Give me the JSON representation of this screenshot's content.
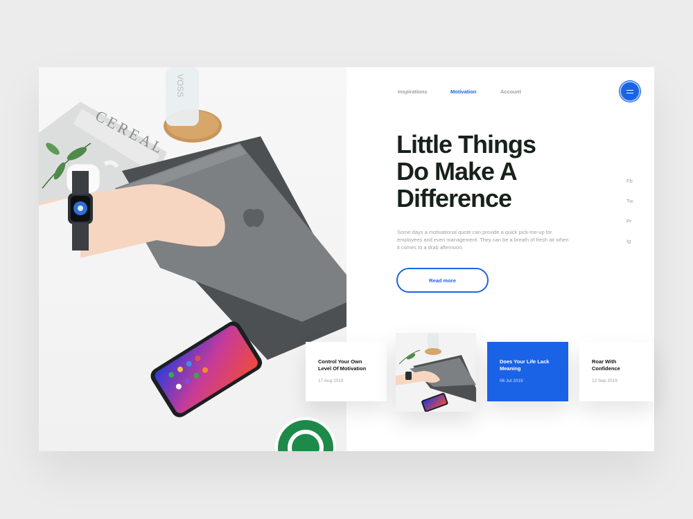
{
  "nav": {
    "items": [
      {
        "label": "Inspirations",
        "active": false
      },
      {
        "label": "Motivation",
        "active": true
      },
      {
        "label": "Account",
        "active": false
      }
    ]
  },
  "hero": {
    "title_line1": "Little Things",
    "title_line2": "Do Make A",
    "title_line3": "Difference",
    "description": "Some days a motivational quote can provide a quick pick-me-up for employees and even management. They can be a breath of fresh air when it comes to a drab afternoon.",
    "cta_label": "Read more"
  },
  "social": [
    "Fb",
    "Tw",
    "Pr",
    "Ig"
  ],
  "posts": [
    {
      "title": "Control Your Own Level Of Motivation",
      "date": "17 Aug 2019"
    },
    {
      "title": "Does Your Life Lack Meaning",
      "date": "06 Jul 2019"
    },
    {
      "title": "Roar With Confidence",
      "date": "12 Sep 2019"
    }
  ],
  "photo": {
    "magazine_text": "CEREAL",
    "bottle_text": "VOSS"
  },
  "colors": {
    "accent": "#1a63e6",
    "title": "#17221a",
    "muted": "#9a9fa6"
  },
  "icons": [
    "menu-icon"
  ]
}
